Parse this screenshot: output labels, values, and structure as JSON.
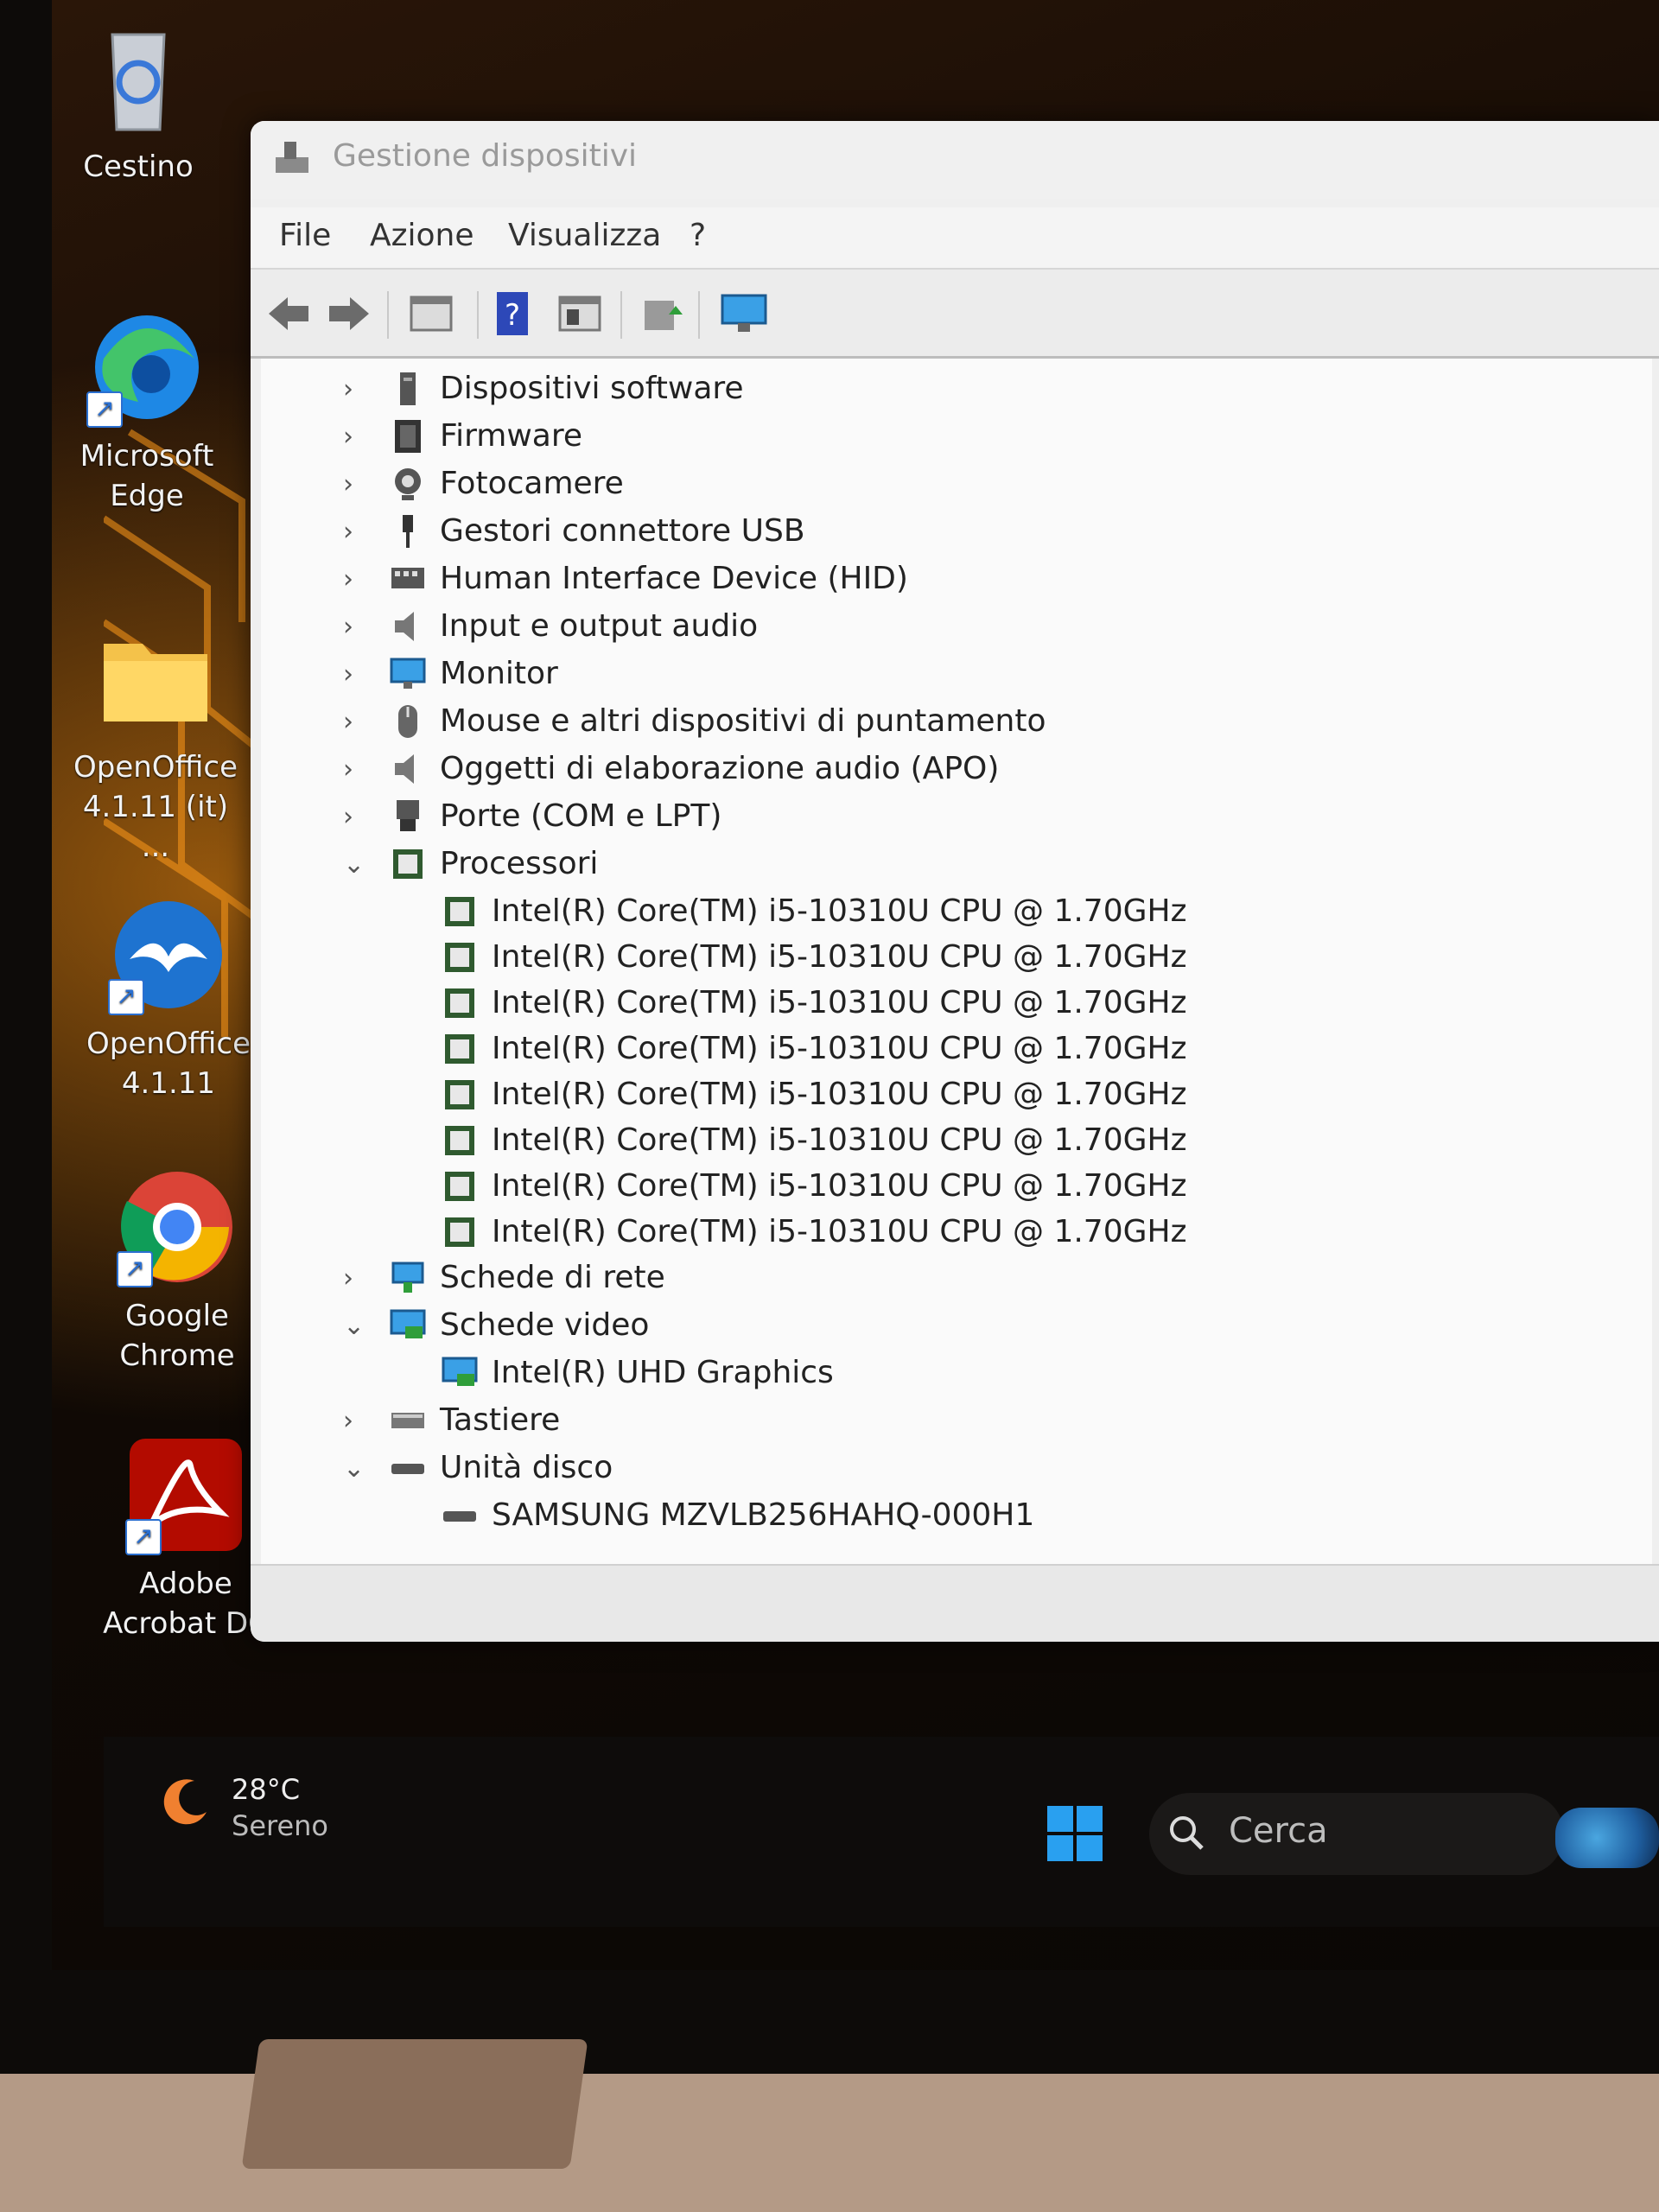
{
  "desktop": {
    "icons": [
      {
        "label_line1": "Cestino",
        "label_line2": ""
      },
      {
        "label_line1": "Microsoft",
        "label_line2": "Edge"
      },
      {
        "label_line1": "OpenOffice",
        "label_line2": "4.1.11 (it) ..."
      },
      {
        "label_line1": "OpenOffice",
        "label_line2": "4.1.11"
      },
      {
        "label_line1": "Google",
        "label_line2": "Chrome"
      },
      {
        "label_line1": "Adobe",
        "label_line2": "Acrobat DC"
      }
    ]
  },
  "window": {
    "title": "Gestione dispositivi",
    "menu": [
      "File",
      "Azione",
      "Visualizza",
      "?"
    ]
  },
  "tree": {
    "categories": [
      {
        "label": "Dispositivi software",
        "icon": "software-device-icon",
        "expanded": false
      },
      {
        "label": "Firmware",
        "icon": "firmware-icon",
        "expanded": false
      },
      {
        "label": "Fotocamere",
        "icon": "camera-icon",
        "expanded": false
      },
      {
        "label": "Gestori connettore USB",
        "icon": "usb-connector-icon",
        "expanded": false
      },
      {
        "label": "Human Interface Device (HID)",
        "icon": "hid-icon",
        "expanded": false
      },
      {
        "label": "Input e output audio",
        "icon": "speaker-icon",
        "expanded": false
      },
      {
        "label": "Monitor",
        "icon": "monitor-icon",
        "expanded": false
      },
      {
        "label": "Mouse e altri dispositivi di puntamento",
        "icon": "mouse-icon",
        "expanded": false
      },
      {
        "label": "Oggetti di elaborazione audio (APO)",
        "icon": "speaker-icon",
        "expanded": false
      },
      {
        "label": "Porte (COM e LPT)",
        "icon": "port-icon",
        "expanded": false
      },
      {
        "label": "Processori",
        "icon": "processor-icon",
        "expanded": true
      },
      {
        "label": "Schede di rete",
        "icon": "network-adapter-icon",
        "expanded": false
      },
      {
        "label": "Schede video",
        "icon": "display-adapter-icon",
        "expanded": true
      },
      {
        "label": "Tastiere",
        "icon": "keyboard-icon",
        "expanded": false
      },
      {
        "label": "Unità disco",
        "icon": "disk-drive-icon",
        "expanded": true
      }
    ],
    "processors": [
      "Intel(R) Core(TM) i5-10310U CPU @ 1.70GHz",
      "Intel(R) Core(TM) i5-10310U CPU @ 1.70GHz",
      "Intel(R) Core(TM) i5-10310U CPU @ 1.70GHz",
      "Intel(R) Core(TM) i5-10310U CPU @ 1.70GHz",
      "Intel(R) Core(TM) i5-10310U CPU @ 1.70GHz",
      "Intel(R) Core(TM) i5-10310U CPU @ 1.70GHz",
      "Intel(R) Core(TM) i5-10310U CPU @ 1.70GHz",
      "Intel(R) Core(TM) i5-10310U CPU @ 1.70GHz"
    ],
    "video": [
      "Intel(R) UHD Graphics"
    ],
    "disks": [
      "SAMSUNG MZVLB256HAHQ-000H1"
    ]
  },
  "taskbar": {
    "weather_temp": "28°C",
    "weather_desc": "Sereno",
    "search_placeholder": "Cerca"
  },
  "colors": {
    "accent": "#1e88e5",
    "window_bg": "#fafafa",
    "taskbar_bg": "#0e0c0b"
  }
}
